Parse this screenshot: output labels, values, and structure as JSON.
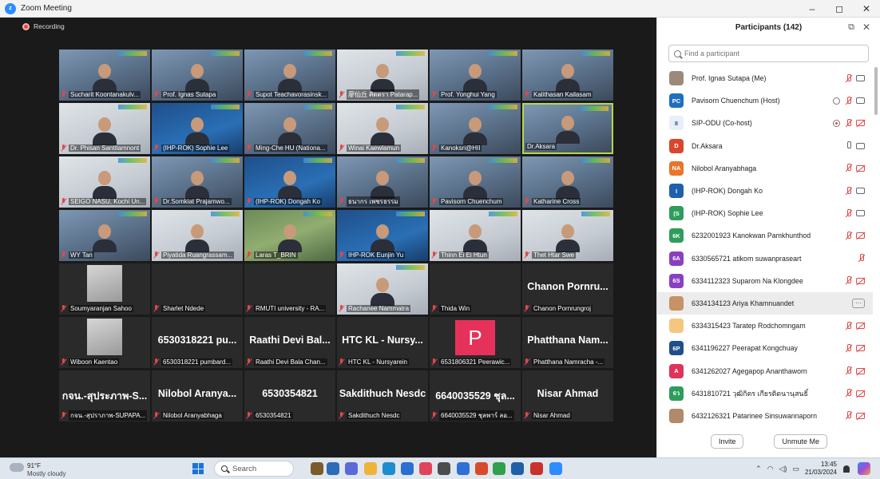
{
  "window": {
    "title": "Zoom Meeting",
    "controls": [
      "–",
      "◻",
      "✕"
    ]
  },
  "meeting": {
    "recording_label": "Recording"
  },
  "tiles": [
    {
      "name": "Sucharit Koontanakulv...",
      "kind": "video",
      "muted": true,
      "style": ""
    },
    {
      "name": "Prof. Ignas Sutapa",
      "kind": "video",
      "muted": true,
      "style": ""
    },
    {
      "name": "Supot Teachavorasinsk...",
      "kind": "video",
      "muted": true,
      "style": ""
    },
    {
      "name": "廖仙丘 ศิตตรา Patarap...",
      "kind": "video",
      "muted": true,
      "style": "light"
    },
    {
      "name": "Prof. Yonghui Yang",
      "kind": "video",
      "muted": true,
      "style": ""
    },
    {
      "name": "Kalithasan Kailasam",
      "kind": "video",
      "muted": true,
      "style": ""
    },
    {
      "name": "Dr. Phisan Santitamnont",
      "kind": "video",
      "muted": true,
      "style": "light"
    },
    {
      "name": "(IHP-ROK) Sophie Lee",
      "kind": "video",
      "muted": true,
      "style": "blue"
    },
    {
      "name": "Ming-Che HU (Nationa...",
      "kind": "video",
      "muted": true,
      "style": ""
    },
    {
      "name": "Winai Kaewlamun",
      "kind": "video",
      "muted": true,
      "style": "light"
    },
    {
      "name": "Kanoksri@HII",
      "kind": "video",
      "muted": true,
      "style": ""
    },
    {
      "name": "Dr.Aksara",
      "kind": "video",
      "muted": false,
      "style": "",
      "active": true
    },
    {
      "name": "SEIGO NASU, Kochi Un...",
      "kind": "video",
      "muted": true,
      "style": "light"
    },
    {
      "name": "Dr.Somkiat Prajamwo...",
      "kind": "video",
      "muted": true,
      "style": ""
    },
    {
      "name": "(IHP-ROK) Dongah Ko",
      "kind": "video",
      "muted": true,
      "style": "blue"
    },
    {
      "name": "ธนากร เพชรธรรม",
      "kind": "video",
      "muted": true,
      "style": ""
    },
    {
      "name": "Pavisorn Chuenchum",
      "kind": "video",
      "muted": true,
      "style": ""
    },
    {
      "name": "Katharine Cross",
      "kind": "video",
      "muted": true,
      "style": ""
    },
    {
      "name": "WY Tan",
      "kind": "video",
      "muted": true,
      "style": ""
    },
    {
      "name": "Piyatida Ruangrassam...",
      "kind": "video",
      "muted": true,
      "style": "light"
    },
    {
      "name": "Laras T_BRIN",
      "kind": "video",
      "muted": true,
      "style": "green"
    },
    {
      "name": "IHP-ROK Eunjin Yu",
      "kind": "video",
      "muted": true,
      "style": "blue"
    },
    {
      "name": "Thinn Ei Ei Htun",
      "kind": "video",
      "muted": true,
      "style": "light"
    },
    {
      "name": "Thet Htar Swe",
      "kind": "video",
      "muted": true,
      "style": "light"
    },
    {
      "name": "Soumyaranjan Sahoo",
      "kind": "thumb",
      "muted": true
    },
    {
      "name": "Sharlet Ndede",
      "kind": "empty",
      "muted": true
    },
    {
      "name": "RMUTI university - RA...",
      "kind": "empty",
      "muted": true
    },
    {
      "name": "Rachanee Nammatra",
      "kind": "video",
      "muted": true,
      "style": "light"
    },
    {
      "name": "Thida Win",
      "kind": "empty",
      "muted": true
    },
    {
      "name": "Chanon Pornrungroj",
      "kind": "text",
      "display": "Chanon Pornru...",
      "muted": true
    },
    {
      "name": "Wiboon Kaentao",
      "kind": "thumb",
      "muted": true
    },
    {
      "name": "6530318221 pumbard...",
      "kind": "text",
      "display": "6530318221 pu...",
      "muted": true
    },
    {
      "name": "Raathi Devi Bala Chan...",
      "kind": "text",
      "display": "Raathi Devi Bal...",
      "muted": true
    },
    {
      "name": "HTC KL - Nursyarein",
      "kind": "text",
      "display": "HTC KL - Nursy...",
      "muted": true
    },
    {
      "name": "6531806321 Peerawic...",
      "kind": "letter",
      "display": "P",
      "muted": true
    },
    {
      "name": "Phatthana Namracha -...",
      "kind": "text",
      "display": "Phatthana Nam...",
      "muted": true
    },
    {
      "name": "กจน.-สุปราภาพ-SUPAPA...",
      "kind": "text",
      "display": "กจน.-สุประภาพ-S...",
      "muted": true
    },
    {
      "name": "Nilobol Aranyabhaga",
      "kind": "text",
      "display": "Nilobol Aranya...",
      "muted": true
    },
    {
      "name": "6530354821",
      "kind": "text",
      "display": "6530354821",
      "muted": true
    },
    {
      "name": "Sakdithuch Nesdc",
      "kind": "text",
      "display": "Sakdithuch Nesdc",
      "muted": true
    },
    {
      "name": "6640035529 ชุลพาร์ ลอ...",
      "kind": "text",
      "display": "6640035529 ชุล...",
      "muted": true
    },
    {
      "name": "Nisar Ahmad",
      "kind": "text",
      "display": "Nisar Ahmad",
      "muted": true
    }
  ],
  "panel": {
    "title": "Participants (142)",
    "search_placeholder": "Find a participant",
    "participants": [
      {
        "name": "Prof. Ignas Sutapa (Me)",
        "initials": "",
        "color": "#9b8a7a",
        "photo": true,
        "mic": "off",
        "cam": "on"
      },
      {
        "name": "Pavisorn Chuenchum (Host)",
        "initials": "PC",
        "color": "#1f6fbf",
        "mic": "off",
        "cam": "on",
        "rec": "plain"
      },
      {
        "name": "SIP-ODU (Co-host)",
        "initials": "8",
        "color": "#e9eef7",
        "light": true,
        "mic": "off",
        "cam": "off",
        "rec": "red"
      },
      {
        "name": "Dr.Aksara",
        "initials": "D",
        "color": "#d8462c",
        "mic": "on",
        "cam": "on"
      },
      {
        "name": "Nilobol Aranyabhaga",
        "initials": "NA",
        "color": "#e8762a",
        "mic": "off",
        "cam": "off"
      },
      {
        "name": "(IHP-ROK) Dongah Ko",
        "initials": "I",
        "color": "#1f5fae",
        "mic": "off",
        "cam": "on"
      },
      {
        "name": "(IHP-ROK) Sophie Lee",
        "initials": "(S",
        "color": "#2e9d5b",
        "mic": "off",
        "cam": "on"
      },
      {
        "name": "6232001923 Kanokwan Pamkhunthod",
        "initials": "6K",
        "color": "#2e9d5b",
        "mic": "off",
        "cam": "off"
      },
      {
        "name": "6330565721 atikom suwanpraseart",
        "initials": "6A",
        "color": "#8a3fc0",
        "mic": "off",
        "cam": "none"
      },
      {
        "name": "6334112323 Suparom Na Klongdee",
        "initials": "6S",
        "color": "#8a3fc0",
        "mic": "off",
        "cam": "off"
      },
      {
        "name": "6334134123 Ariya Khamnuandet",
        "initials": "",
        "color": "#c79266",
        "photo": true,
        "more": true
      },
      {
        "name": "6334315423 Taratep Rodchomngam",
        "initials": "",
        "color": "#f5c77e",
        "photo": true,
        "mic": "off",
        "cam": "off"
      },
      {
        "name": "6341196227 Peerapat Kongchuay",
        "initials": "6P",
        "color": "#1f4f8a",
        "mic": "off",
        "cam": "off"
      },
      {
        "name": "6341262027 Agegapop Ananthaworn",
        "initials": "A",
        "color": "#e0335a",
        "mic": "off",
        "cam": "off"
      },
      {
        "name": "6431810721 วุฒิกิตร เกียรติดนานุสนธิ์",
        "initials": "6ว",
        "color": "#2e9d5b",
        "mic": "off",
        "cam": "off"
      },
      {
        "name": "6432126321 Patarinee Sinsuwannaporn",
        "initials": "",
        "color": "#b08a6a",
        "photo": true,
        "mic": "off",
        "cam": "off"
      }
    ],
    "invite_label": "Invite",
    "unmute_label": "Unmute Me"
  },
  "taskbar": {
    "temp": "91°F",
    "weather": "Mostly cloudy",
    "search_label": "Search",
    "time": "13:45",
    "date": "21/03/2024"
  }
}
